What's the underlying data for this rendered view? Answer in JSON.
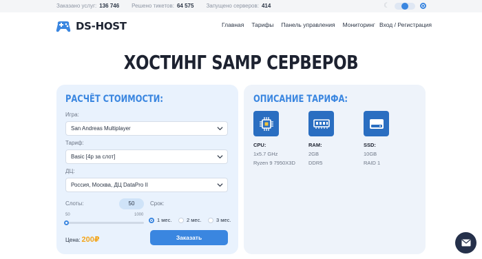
{
  "stats": [
    {
      "label": "Заказано услуг:",
      "value": "136 746"
    },
    {
      "label": "Решено тикетов:",
      "value": "64 575"
    },
    {
      "label": "Запущено серверов:",
      "value": "414"
    }
  ],
  "header": {
    "logo_text": "DS-HOST",
    "nav": [
      "Главная",
      "Тарифы",
      "Панель управления",
      "Мониторинг"
    ],
    "login": "Вход / Регистрация"
  },
  "hero": {
    "title": "ХОСТИНГ SAMP СЕРВЕРОВ"
  },
  "calculator": {
    "title": "РАСЧЁТ СТОИМОСТИ:",
    "game_label": "Игра:",
    "game_value": "San Andreas Multiplayer",
    "tariff_label": "Тариф:",
    "tariff_value": "Basic [4р за слот]",
    "dc_label": "ДЦ:",
    "dc_value": "Россия, Москва, ДЦ DataPro II",
    "slots_label": "Слоты:",
    "slots_value": "50",
    "slots_min": "50",
    "slots_max": "1000",
    "term_label": "Срок:",
    "terms": [
      "1 мес.",
      "2 мес.",
      "3 мес."
    ],
    "selected_term": "1 мес.",
    "price_label": "Цена:",
    "price_value": "200₽",
    "order_button": "Заказать"
  },
  "tariff": {
    "title": "ОПИСАНИЕ ТАРИФА:",
    "specs": [
      {
        "name": "CPU:",
        "line1": "1x5.7 GHz",
        "line2": "Ryzen 9 7950X3D",
        "icon": "cpu-icon"
      },
      {
        "name": "RAM:",
        "line1": "2GB",
        "line2": "DDR5",
        "icon": "ram-icon"
      },
      {
        "name": "SSD:",
        "line1": "10GB",
        "line2": "RAID 1",
        "icon": "ssd-icon"
      }
    ]
  },
  "colors": {
    "accent": "#3a86e0",
    "price": "#f3a51b",
    "panel": "#e9f2fd",
    "chat": "#25304a"
  }
}
